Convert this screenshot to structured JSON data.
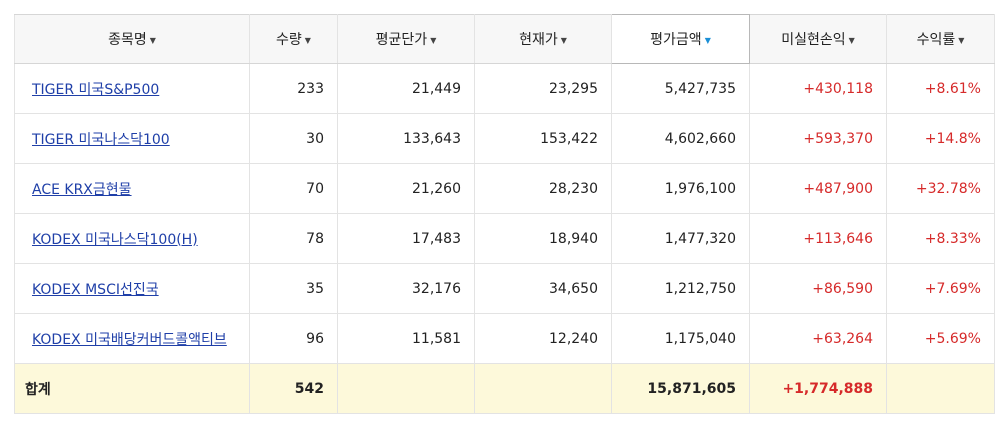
{
  "columns": [
    {
      "label": "종목명",
      "sorted": false
    },
    {
      "label": "수량",
      "sorted": false
    },
    {
      "label": "평균단가",
      "sorted": false
    },
    {
      "label": "현재가",
      "sorted": false
    },
    {
      "label": "평가금액",
      "sorted": true
    },
    {
      "label": "미실현손익",
      "sorted": false
    },
    {
      "label": "수익률",
      "sorted": false
    }
  ],
  "rows": [
    {
      "name": "TIGER 미국S&P500",
      "qty": "233",
      "avg_price": "21,449",
      "current_price": "23,295",
      "valuation": "5,427,735",
      "unrealized": "+430,118",
      "return_rate": "+8.61%"
    },
    {
      "name": "TIGER 미국나스닥100",
      "qty": "30",
      "avg_price": "133,643",
      "current_price": "153,422",
      "valuation": "4,602,660",
      "unrealized": "+593,370",
      "return_rate": "+14.8%"
    },
    {
      "name": "ACE KRX금현물",
      "qty": "70",
      "avg_price": "21,260",
      "current_price": "28,230",
      "valuation": "1,976,100",
      "unrealized": "+487,900",
      "return_rate": "+32.78%"
    },
    {
      "name": "KODEX 미국나스닥100(H)",
      "qty": "78",
      "avg_price": "17,483",
      "current_price": "18,940",
      "valuation": "1,477,320",
      "unrealized": "+113,646",
      "return_rate": "+8.33%"
    },
    {
      "name": "KODEX MSCI선진국",
      "qty": "35",
      "avg_price": "32,176",
      "current_price": "34,650",
      "valuation": "1,212,750",
      "unrealized": "+86,590",
      "return_rate": "+7.69%"
    },
    {
      "name": "KODEX 미국배당커버드콜액티브",
      "qty": "96",
      "avg_price": "11,581",
      "current_price": "12,240",
      "valuation": "1,175,040",
      "unrealized": "+63,264",
      "return_rate": "+5.69%"
    }
  ],
  "total": {
    "label": "합계",
    "qty": "542",
    "valuation": "15,871,605",
    "unrealized": "+1,774,888"
  },
  "colors": {
    "positive": "#d62a2a",
    "link": "#1f3fa8",
    "sort_active": "#1a8fd6",
    "total_row_bg": "#fdf9da"
  },
  "icons": {
    "sort_caret": "caret-down-icon"
  }
}
